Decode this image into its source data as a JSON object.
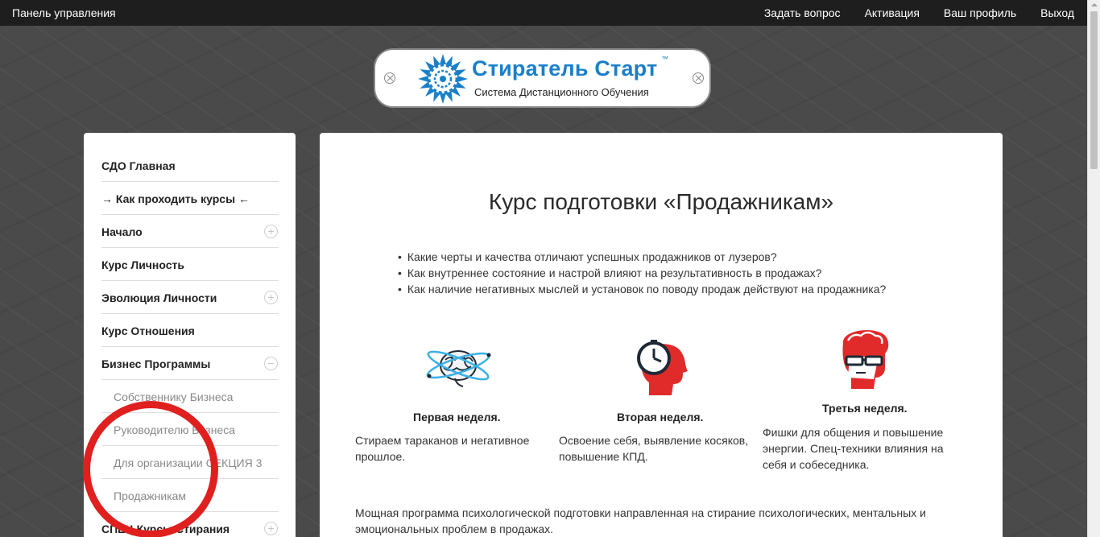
{
  "topbar": {
    "brand": "Панель управления",
    "nav": {
      "ask": "Задать вопрос",
      "activation": "Активация",
      "profile": "Ваш профиль",
      "logout": "Выход"
    }
  },
  "logo": {
    "title": "Стиратель Старт",
    "trademark": "™",
    "subtitle": "Система Дистанционного Обучения"
  },
  "sidebar": {
    "items": [
      {
        "label": "СДО Главная"
      },
      {
        "label": "→ Как проходить курсы ←"
      },
      {
        "label": "Начало",
        "toggle": "+"
      },
      {
        "label": "Курс Личность"
      },
      {
        "label": "Эволюция Личности",
        "toggle": "+"
      },
      {
        "label": "Курс Отношения"
      },
      {
        "label": "Бизнес Программы",
        "toggle": "−"
      },
      {
        "label": "Собственнику Бизнеса"
      },
      {
        "label": "Руководителю Бизнеса"
      },
      {
        "label": "Для организации СЕКЦИЯ 3"
      },
      {
        "label": "Продажникам"
      },
      {
        "label": "СПЕЦ Курсы Стирания",
        "toggle": "+"
      }
    ]
  },
  "content": {
    "heading": "Курс подготовки «Продажникам»",
    "bullets": [
      "Какие черты и качества отличают успешных продажников от лузеров?",
      "Как внутреннее состояние и настрой влияют на результативность в продажах?",
      "Как наличие негативных мыслей и установок по поводу продаж действуют на продажника?"
    ],
    "weeks": [
      {
        "title": "Первая неделя.",
        "text": "Стираем тараканов и негативное прошлое.",
        "icon": "brain-icon"
      },
      {
        "title": "Вторая неделя.",
        "text": "Освоение себя, выявление косяков, повышение КПД.",
        "icon": "head-clock-icon"
      },
      {
        "title": "Третья неделя.",
        "text": "Фишки для общения и повышение энергии. Спец-техники влияния на себя и собеседника.",
        "icon": "head-glasses-icon"
      }
    ],
    "paragraph": "Мощная программа психологической подготовки направленная на стирание психологических, ментальных и эмоциональных проблем в продажах."
  },
  "colors": {
    "accent_blue": "#1a7fc9",
    "accent_red": "#e01f1f",
    "topbar": "#1e1e1e"
  }
}
